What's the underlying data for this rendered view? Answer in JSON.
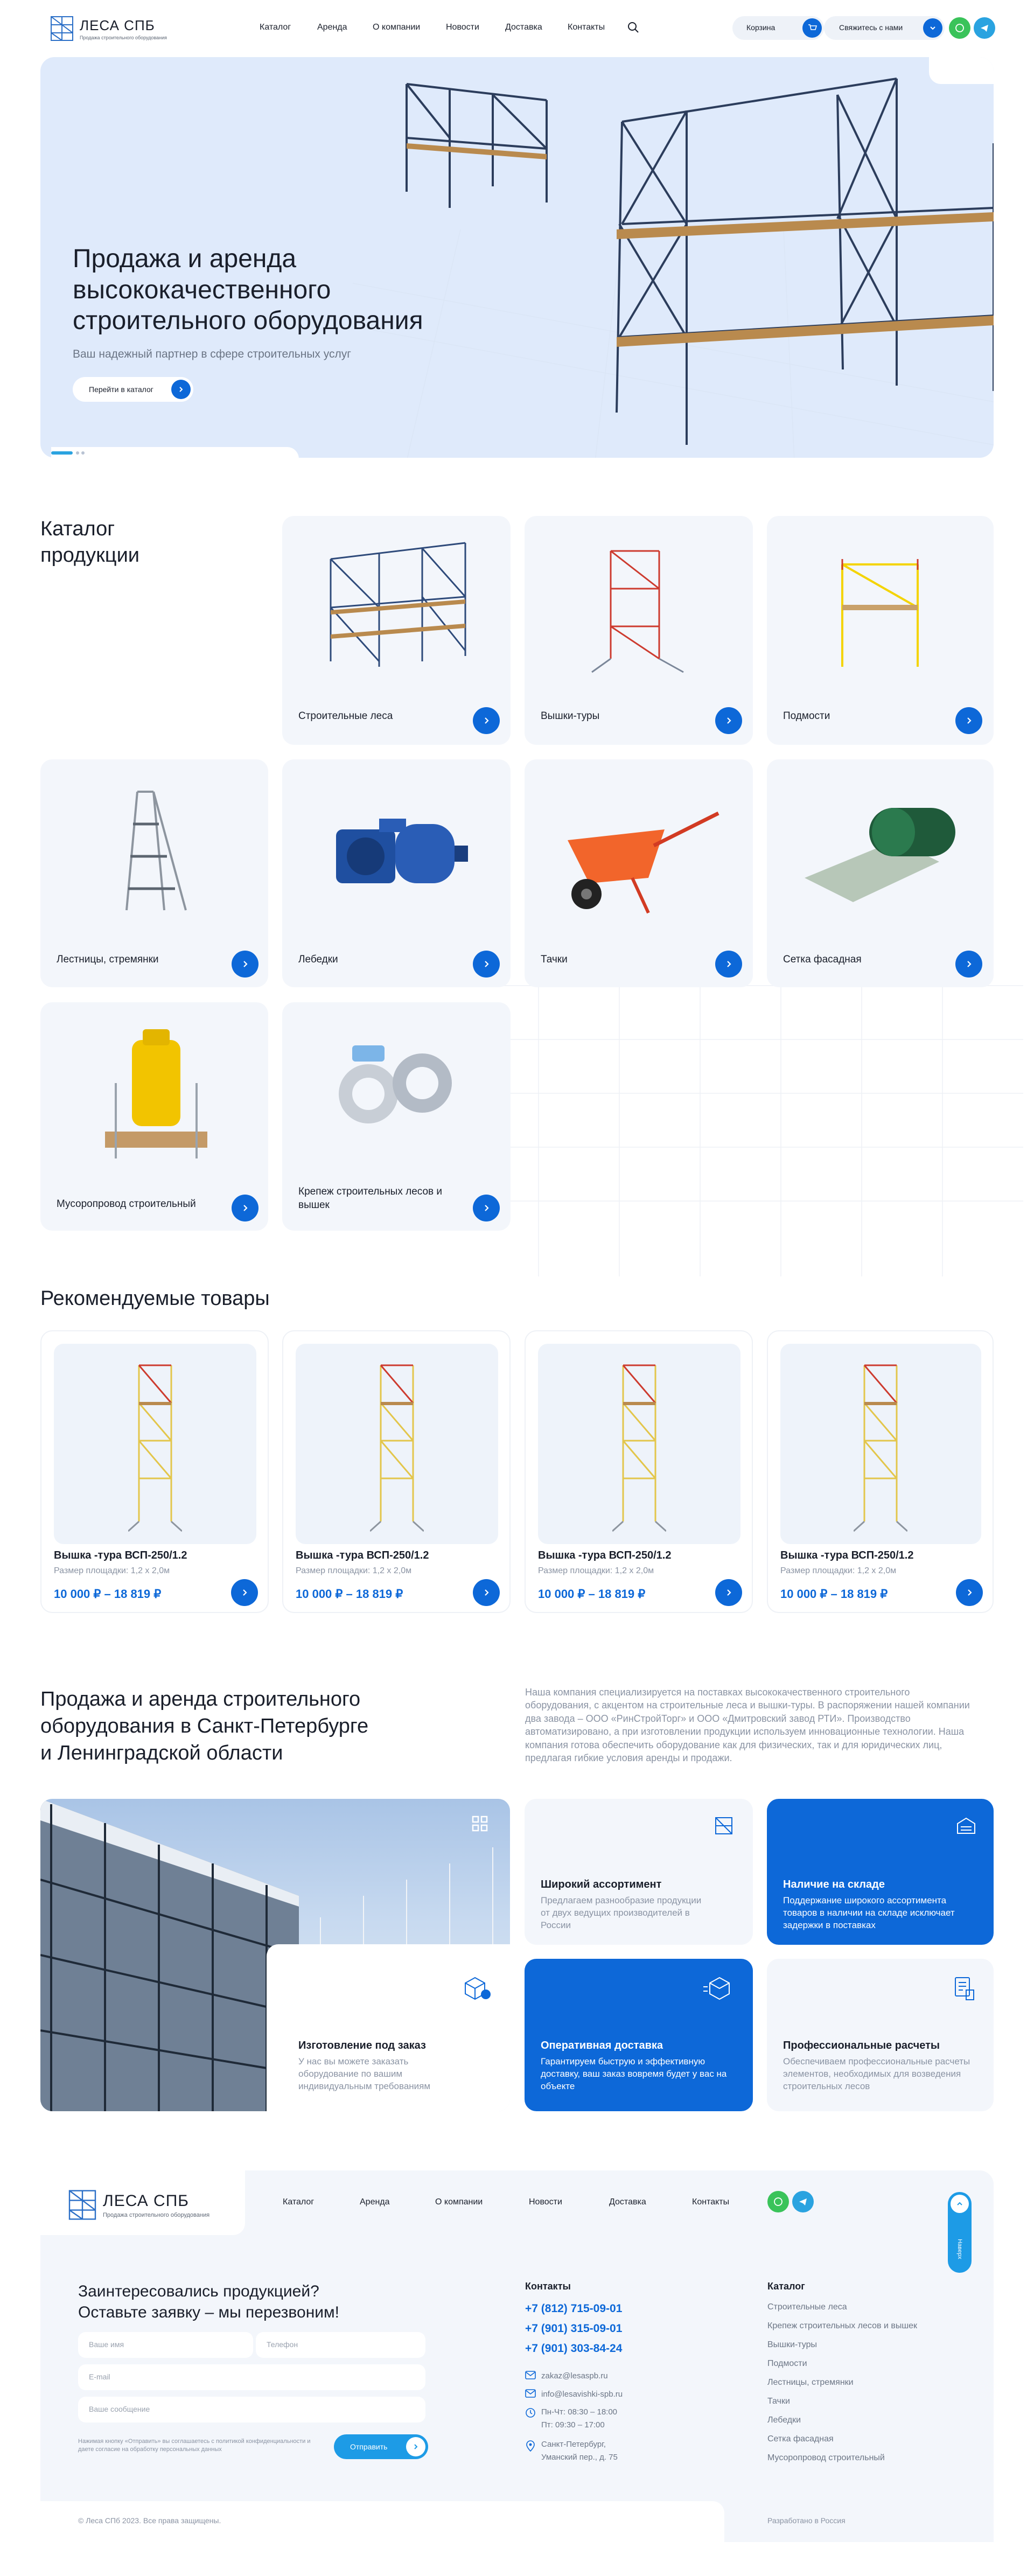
{
  "header": {
    "logo_title": "ЛЕСА СПБ",
    "logo_subtitle": "Продажа строительного оборудования",
    "nav": [
      "Каталог",
      "Аренда",
      "О компании",
      "Новости",
      "Доставка",
      "Контакты"
    ],
    "cart_label": "Корзина",
    "contact_label": "Свяжитесь с нами"
  },
  "hero": {
    "title_l1": "Продажа и аренда",
    "title_l2": "высококачественного",
    "title_l3": "строительного оборудования",
    "subtitle": "Ваш надежный партнер в сфере строительных услуг",
    "button": "Перейти в каталог",
    "slide_index": 1,
    "slide_count": 3
  },
  "catalog": {
    "title_l1": "Каталог",
    "title_l2": "продукции",
    "items": [
      "Строительные леса",
      "Вышки-туры",
      "Подмости",
      "Лестницы, стремянки",
      "Лебедки",
      "Тачки",
      "Сетка фасадная",
      "Мусоропровод строительный",
      "Крепеж строительных лесов и вышек"
    ]
  },
  "recommended": {
    "title": "Рекомендуемые товары",
    "products": [
      {
        "name": "Вышка -тура ВСП-250/1.2",
        "size": "Размер площадки: 1,2 х 2,0м",
        "price": "10 000 ₽ – 18 819 ₽"
      },
      {
        "name": "Вышка -тура ВСП-250/1.2",
        "size": "Размер площадки: 1,2 х 2,0м",
        "price": "10 000 ₽ – 18 819 ₽"
      },
      {
        "name": "Вышка -тура ВСП-250/1.2",
        "size": "Размер площадки: 1,2 х 2,0м",
        "price": "10 000 ₽ – 18 819 ₽"
      },
      {
        "name": "Вышка -тура ВСП-250/1.2",
        "size": "Размер площадки: 1,2 х 2,0м",
        "price": "10 000 ₽ – 18 819 ₽"
      }
    ]
  },
  "about": {
    "title_l1": "Продажа и аренда строительного",
    "title_l2": "оборудования в Санкт-Петербурге",
    "title_l3": "и Ленинградской области",
    "text": "Наша компания специализируется на поставках высококачественного строительного оборудования, с акцентом на строительные леса и вышки-туры. В распоряжении нашей компании два завода – ООО «РинСтройТорг» и ООО «Дмитровский завод РТИ». Производство автоматизировано, а при изготовлении продукции используем инновационные технологии. Наша компания готова обеспечить оборудование как для физических, так и для юридических лиц, предлагая гибкие условия аренды и продажи.",
    "features": [
      {
        "title": "Широкий ассортимент",
        "text": "Предлагаем разнообразие продукции от двух ведущих производителей в России"
      },
      {
        "title": "Наличие на складе",
        "text": "Поддержание широкого ассортимента товаров в наличии на складе исключает задержки в поставках"
      },
      {
        "title": "Изготовление под заказ",
        "text": "У нас вы можете заказать оборудование по вашим индивидуальным требованиям"
      },
      {
        "title": "Оперативная доставка",
        "text": "Гарантируем быструю и эффективную доставку, ваш заказ вовремя будет у вас на объекте"
      },
      {
        "title": "Профессиональные расчеты",
        "text": "Обеспечиваем профессиональные расчеты элементов, необходимых для возведения строительных лесов"
      }
    ]
  },
  "footer": {
    "logo_title": "ЛЕСА СПБ",
    "logo_subtitle": "Продажа строительного оборудования",
    "nav": [
      "Каталог",
      "Аренда",
      "О компании",
      "Новости",
      "Доставка",
      "Контакты"
    ],
    "up_label": "Наверх",
    "form_title_l1": "Заинтересовались продукцией?",
    "form_title_l2": "Оставьте заявку – мы перезвоним!",
    "ph_name": "Ваше имя",
    "ph_phone": "Телефон",
    "ph_email": "E-mail",
    "ph_message": "Ваше сообщение",
    "consent": "Нажимая кнопку «Отправить» вы соглашаетесь с политикой конфиденциальности и даете согласие на обработку персональных данных",
    "submit": "Отправить",
    "contacts_title": "Контакты",
    "phones": [
      "+7 (812) 715-09-01",
      "+7 (901) 315-09-01",
      "+7 (901) 303-84-24"
    ],
    "email1": "zakaz@lesaspb.ru",
    "email2": "info@lesavishki-spb.ru",
    "hours1": "Пн-Чт: 08:30 – 18:00",
    "hours2": "Пт: 09:30 – 17:00",
    "address1": "Санкт-Петербург,",
    "address2": "Уманский пер., д. 75",
    "catalog_title": "Каталог",
    "catalog_links": [
      "Строительные леса",
      "Крепеж строительных лесов и вышек",
      "Вышки-туры",
      "Подмости",
      "Лестницы, стремянки",
      "Тачки",
      "Лебедки",
      "Сетка фасадная",
      "Мусоропровод строительный"
    ],
    "copyright": "© Леса СПб 2023. Все права защищены.",
    "developer": "Разработано в Россия"
  },
  "colors": {
    "accent": "#0d68d8",
    "light_bg": "#f3f6fb",
    "hero_bg": "#dfeafb",
    "whatsapp": "#3ac35a",
    "telegram": "#2aa3e0"
  }
}
